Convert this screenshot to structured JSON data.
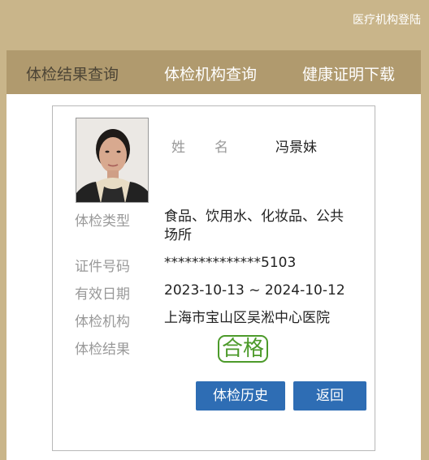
{
  "header": {
    "login_link": "医疗机构登陆"
  },
  "nav": {
    "tabs": [
      {
        "label": "体检结果查询",
        "active": true
      },
      {
        "label": "体检机构查询",
        "active": false
      },
      {
        "label": "健康证明下载",
        "active": false
      }
    ]
  },
  "card": {
    "name_label_1": "姓",
    "name_label_2": "名",
    "name_value": "冯景妹",
    "rows": [
      {
        "label": "体检类型",
        "value": "食品、饮用水、化妆品、公共场所"
      },
      {
        "label": "证件号码",
        "value": "**************5103"
      },
      {
        "label": "有效日期",
        "value": "2023-10-13 ~ 2024-10-12"
      },
      {
        "label": "体检机构",
        "value": "上海市宝山区吴淞中心医院"
      },
      {
        "label": "体检结果",
        "value": ""
      }
    ],
    "result": "合格",
    "result_color": "#4c9a2a",
    "buttons": {
      "history": "体检历史",
      "back": "返回"
    }
  },
  "colors": {
    "background": "#c9b58a",
    "navbar": "#b09a6e",
    "button": "#2e6db4"
  }
}
